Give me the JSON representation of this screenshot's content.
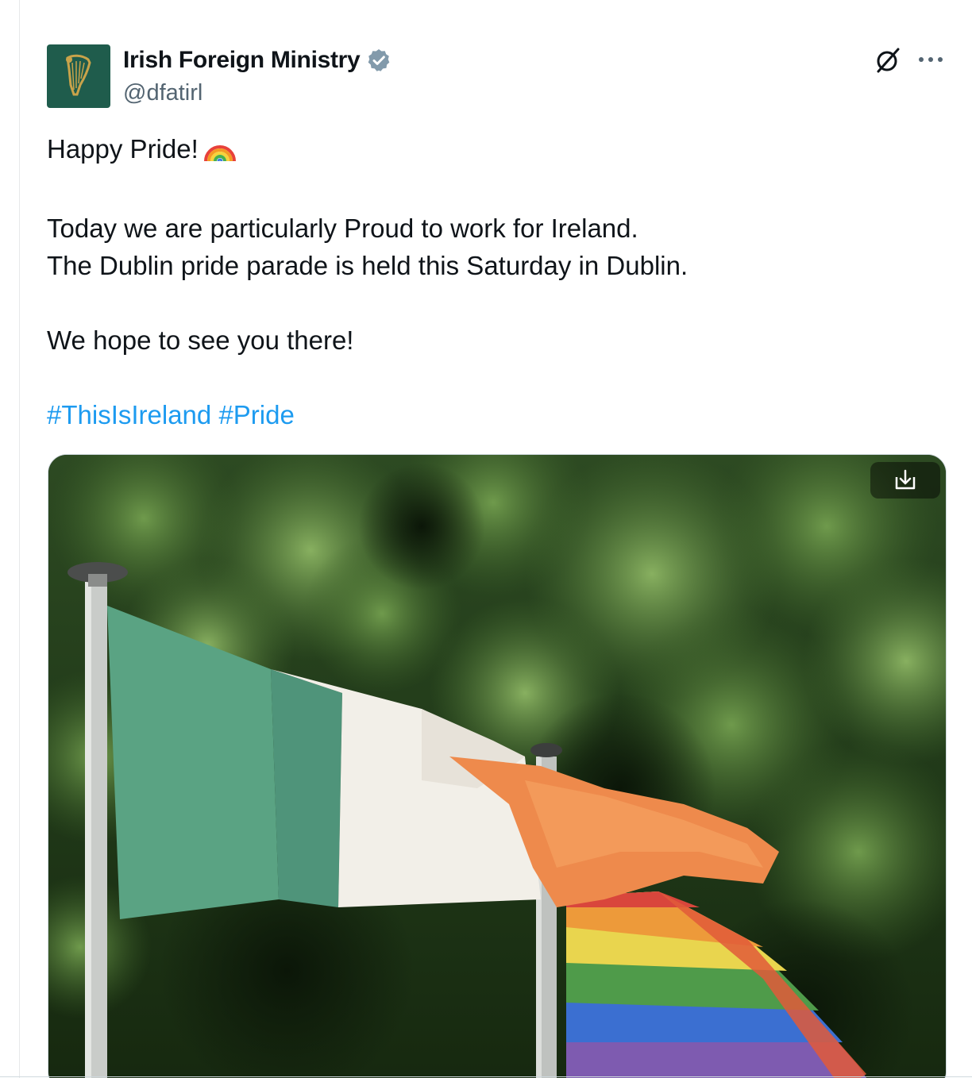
{
  "author": {
    "display_name": "Irish Foreign Ministry",
    "handle": "@dfatirl",
    "verified": true,
    "avatar_icon": "harp-icon",
    "avatar_color": "#1f5c4c"
  },
  "actions": {
    "grok_icon": "grok-icon",
    "more_icon": "more-dots-icon",
    "download_icon": "download-icon"
  },
  "tweet": {
    "line1": "Happy Pride!",
    "line1_emoji": "rainbow-emoji",
    "line2": "Today we are particularly Proud to work for Ireland.",
    "line3": "The Dublin pride parade is held this Saturday in Dublin.",
    "line4": "We hope to see you there!",
    "hashtags": [
      "#ThisIsIreland",
      "#Pride"
    ]
  },
  "colors": {
    "text": "#0f1419",
    "secondary": "#536471",
    "link": "#1d9bf0",
    "verified_badge": "#829aab"
  }
}
